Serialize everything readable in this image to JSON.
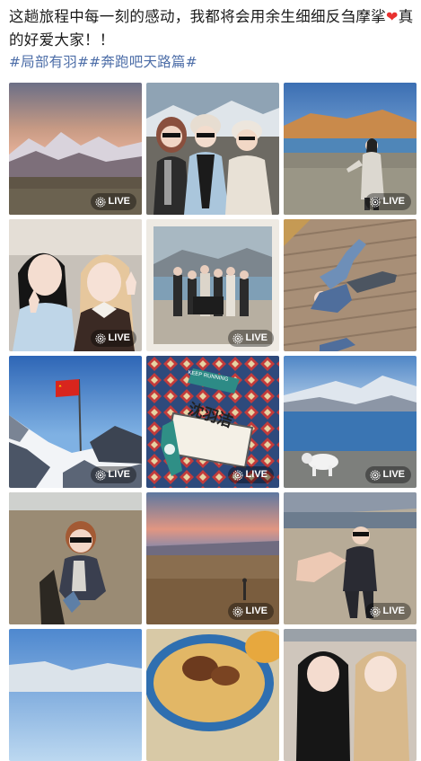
{
  "post": {
    "text_before_heart": "这趟旅程中每一刻的感动，我都将会用余生细细反刍摩挲",
    "heart_icon": "red-heart-icon",
    "text_after_heart": "真的好爱大家！！",
    "hashtags": "#局部有羽##奔跑吧天路篇#"
  },
  "live_label": "LIVE",
  "photo_tag_text": "沈羽洁",
  "photo_tag_top": "KEEP RUNNING",
  "colors": {
    "hashtag": "#4d6ea8",
    "heart": "#e8312f",
    "text": "#1a1a1a"
  },
  "photos": [
    {
      "name": "sunset-snow-mountains",
      "live": true
    },
    {
      "name": "friends-selfie-mountains",
      "live": true
    },
    {
      "name": "woman-by-lake",
      "live": true
    },
    {
      "name": "two-girls-selfie",
      "live": true
    },
    {
      "name": "group-photo-lake",
      "live": true
    },
    {
      "name": "lying-on-wooden-deck",
      "live": false
    },
    {
      "name": "flag-on-mountain",
      "live": true
    },
    {
      "name": "name-tag-close-up",
      "live": true
    },
    {
      "name": "yak-by-lake",
      "live": true
    },
    {
      "name": "girl-sunglasses-wide-angle",
      "live": false
    },
    {
      "name": "dusk-landscape",
      "live": true
    },
    {
      "name": "man-pointing-wide-angle",
      "live": true
    },
    {
      "name": "sky-partial",
      "live": false
    },
    {
      "name": "food-platter",
      "live": false
    },
    {
      "name": "two-girls-partial",
      "live": false
    }
  ]
}
